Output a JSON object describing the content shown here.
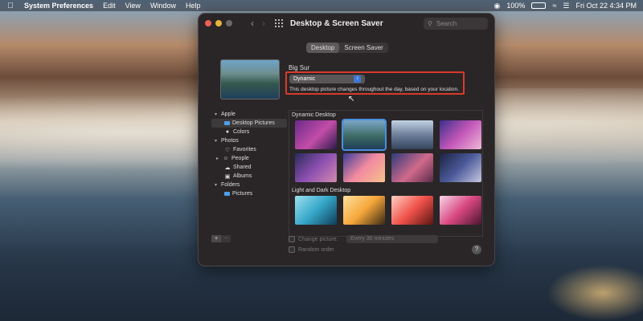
{
  "menubar": {
    "app": "System Preferences",
    "items": [
      "Edit",
      "View",
      "Window",
      "Help"
    ],
    "battery_percent": "100%",
    "datetime": "Fri Oct 22  4:34 PM"
  },
  "window": {
    "title": "Desktop & Screen Saver",
    "search_placeholder": "Search",
    "tabs": [
      "Desktop",
      "Screen Saver"
    ],
    "active_tab": "Desktop"
  },
  "wallpaper": {
    "name": "Big Sur",
    "mode": "Dynamic",
    "description": "This desktop picture changes throughout the day, based on your location."
  },
  "sidebar": {
    "apple_label": "Apple",
    "desktop_pictures": "Desktop Pictures",
    "colors": "Colors",
    "photos_label": "Photos",
    "favorites": "Favorites",
    "people": "People",
    "shared": "Shared",
    "albums": "Albums",
    "folders_label": "Folders",
    "pictures": "Pictures"
  },
  "gallery": {
    "section1": "Dynamic Desktop",
    "section2": "Light and Dark Desktop"
  },
  "options": {
    "change_picture": "Change picture:",
    "interval": "Every 30 minutes",
    "random_order": "Random order",
    "help": "?"
  },
  "colors": {
    "highlight": "#d93a2a",
    "accent": "#3d78d6"
  }
}
